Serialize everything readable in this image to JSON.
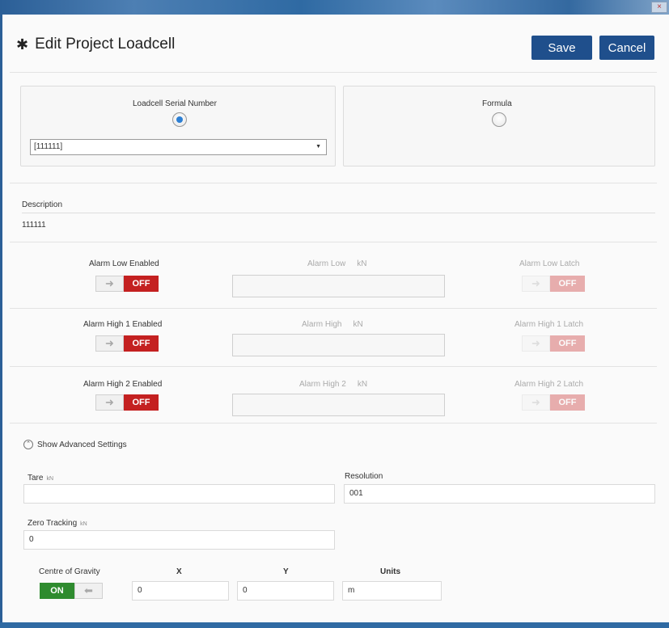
{
  "header": {
    "title": "Edit Project Loadcell",
    "gear_icon": "gear-icon",
    "save_label": "Save",
    "cancel_label": "Cancel"
  },
  "source": {
    "serial_label": "Loadcell Serial Number",
    "serial_selected": "[111111]",
    "formula_label": "Formula"
  },
  "description": {
    "label": "Description",
    "value": "111111"
  },
  "alarms": [
    {
      "enabled_label": "Alarm Low Enabled",
      "enabled_state": "OFF",
      "value_label": "Alarm Low",
      "unit": "kN",
      "value": "",
      "latch_label": "Alarm Low Latch",
      "latch_state": "OFF"
    },
    {
      "enabled_label": "Alarm High 1 Enabled",
      "enabled_state": "OFF",
      "value_label": "Alarm High",
      "unit": "kN",
      "value": "",
      "latch_label": "Alarm High 1 Latch",
      "latch_state": "OFF"
    },
    {
      "enabled_label": "Alarm High 2 Enabled",
      "enabled_state": "OFF",
      "value_label": "Alarm High 2",
      "unit": "kN",
      "value": "",
      "latch_label": "Alarm High 2 Latch",
      "latch_state": "OFF"
    }
  ],
  "advanced": {
    "toggle_label": "Show Advanced Settings",
    "tare_label": "Tare",
    "tare_unit": "kN",
    "tare_value": "",
    "resolution_label": "Resolution",
    "resolution_value": "001",
    "zero_tracking_label": "Zero Tracking",
    "zero_tracking_unit": "kN",
    "zero_tracking_value": "0",
    "cog_label": "Centre of Gravity",
    "cog_state": "ON",
    "x_label": "X",
    "x_value": "0",
    "y_label": "Y",
    "y_value": "0",
    "units_label": "Units",
    "units_value": "m"
  },
  "colors": {
    "accent": "#1f4f8c",
    "off": "#c42020",
    "on": "#2e8b2e"
  }
}
